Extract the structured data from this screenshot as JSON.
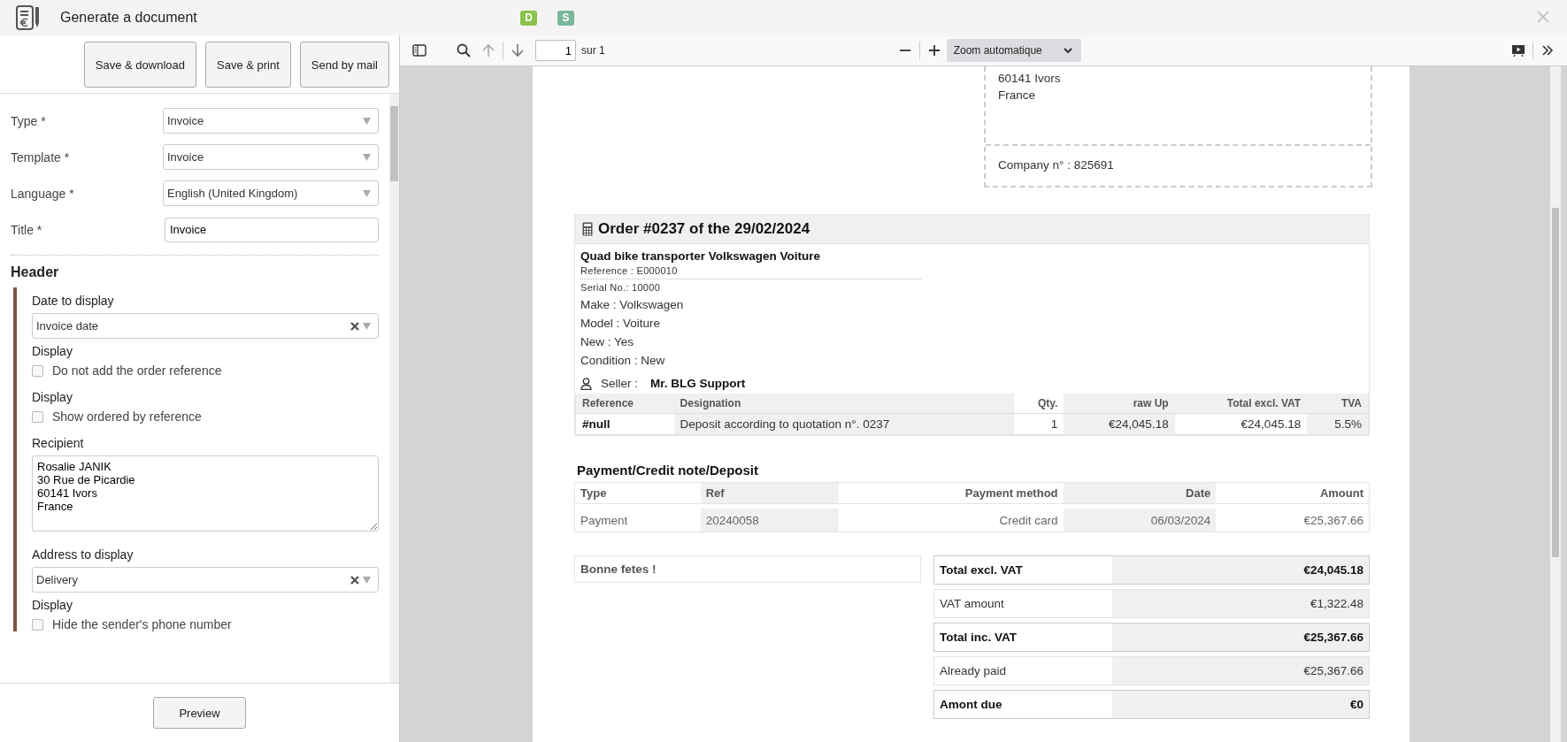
{
  "window": {
    "title": "Generate a document",
    "badges": [
      {
        "label": "D",
        "color": "#8bc34a"
      },
      {
        "label": "S",
        "color": "#7cb79a"
      }
    ]
  },
  "actions": [
    "Save & download",
    "Save & print",
    "Send by mail"
  ],
  "form": {
    "fields": [
      {
        "kind": "select",
        "label": "Type *",
        "value": "Invoice"
      },
      {
        "kind": "select",
        "label": "Template *",
        "value": "Invoice"
      },
      {
        "kind": "select",
        "label": "Language *",
        "value": "English (United Kingdom)"
      },
      {
        "kind": "text",
        "label": "Title *",
        "value": "Invoice"
      }
    ]
  },
  "header_section": {
    "title": "Header",
    "items": [
      {
        "kind": "select",
        "label": "Date to display",
        "value": "Invoice date",
        "clearable": true
      },
      {
        "kind": "checkbox",
        "label": "Display",
        "text": "Do not add the order reference",
        "checked": false
      },
      {
        "kind": "checkbox",
        "label": "Display",
        "text": "Show ordered by reference",
        "checked": false
      },
      {
        "kind": "textarea",
        "label": "Recipient",
        "value": "Rosalie JANIK\n30 Rue de Picardie\n60141 Ivors\nFrance"
      },
      {
        "kind": "select",
        "label": "Address to display",
        "value": "Delivery",
        "clearable": true
      },
      {
        "kind": "checkbox",
        "label": "Display",
        "text": "Hide the sender's phone number",
        "checked": false
      }
    ]
  },
  "footer_button": "Preview",
  "viewer": {
    "page": "1",
    "page_count": "sur 1",
    "zoom": "Zoom automatique"
  },
  "document": {
    "address_lines": [
      "60141 Ivors",
      "France"
    ],
    "company": "Company n° : 825691",
    "order_title": "Order #0237 of the 29/02/2024",
    "product": {
      "name": "Quad bike transporter Volkswagen Voiture",
      "reference": "Reference : E000010",
      "serial": "Serial No.: 10000",
      "attributes": [
        "Make : Volkswagen",
        "Model : Voiture",
        "New : Yes",
        "Condition : New"
      ]
    },
    "seller_label": "Seller :",
    "seller": "Mr. BLG Support",
    "lines": {
      "columns": [
        "Reference",
        "Designation",
        "Qty.",
        "raw Up",
        "Total excl. VAT",
        "TVA"
      ],
      "rows": [
        [
          "#null",
          "Deposit according to quotation n°. 0237",
          "1",
          "€24,045.18",
          "€24,045.18",
          "5.5%"
        ]
      ]
    },
    "payments": {
      "title": "Payment/Credit note/Deposit",
      "columns": [
        "Type",
        "Ref",
        "Payment method",
        "Date",
        "Amount"
      ],
      "rows": [
        [
          "Payment",
          "20240058",
          "Credit card",
          "06/03/2024",
          "€25,367.66"
        ]
      ]
    },
    "note": "Bonne fetes !",
    "totals": [
      {
        "label": "Total excl. VAT",
        "value": "€24,045.18",
        "bold": true
      },
      {
        "label": "VAT amount",
        "value": "€1,322.48",
        "bold": false
      },
      {
        "label": "Total inc. VAT",
        "value": "€25,367.66",
        "bold": true
      },
      {
        "label": "Already paid",
        "value": "€25,367.66",
        "bold": false
      },
      {
        "label": "Amont due",
        "value": "€0",
        "bold": true
      }
    ]
  }
}
